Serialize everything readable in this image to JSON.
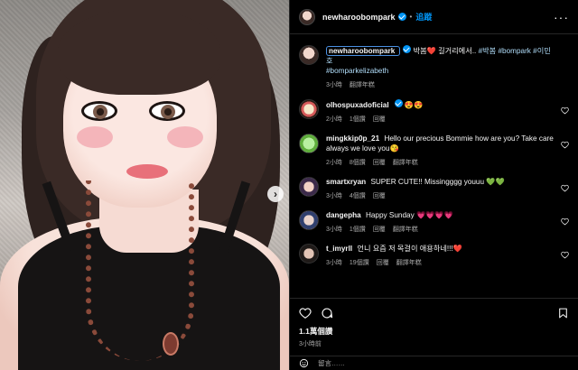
{
  "post": {
    "author": "newharoobompark",
    "follow_label": "追蹤",
    "separator": "•",
    "more_label": "···",
    "caption": {
      "username": "newharoobompark",
      "text_part1": "박봄",
      "emoji": "❤️",
      "text_part2": " 길거리에서..",
      "hashtags_line1": "#박봄 #bompark #이민호",
      "hashtags_line2": "#bomparkelizabeth",
      "time": "3小時",
      "translate": "翻譯年糕"
    },
    "carousel_next": "›",
    "likes": "1.1萬個讚",
    "posted": "3小時前",
    "comment_placeholder": "留言……"
  },
  "comments": [
    {
      "user": "olhospuxadoficial",
      "verified": true,
      "text": "😍😍",
      "time": "2小時",
      "likes": "1個讚",
      "reply": "回覆",
      "translate": ""
    },
    {
      "user": "mingkkip0p_21",
      "verified": false,
      "text": "Hello our precious Bommie how are you? Take care always we love you😘",
      "time": "2小時",
      "likes": "8個讚",
      "reply": "回覆",
      "translate": "翻譯年糕"
    },
    {
      "user": "smartxryan",
      "verified": false,
      "text": "SUPER CUTE!! Missingggg youuu 💚💚",
      "time": "3小時",
      "likes": "4個讚",
      "reply": "回覆",
      "translate": ""
    },
    {
      "user": "dangepha",
      "verified": false,
      "text": "Happy Sunday 💗💗💗💗",
      "time": "3小時",
      "likes": "1個讚",
      "reply": "回覆",
      "translate": "翻譯年糕"
    },
    {
      "user": "t_imyrll",
      "verified": false,
      "text": "언니 요즘 저 목걸이 애용하네!!!❤️",
      "time": "3小時",
      "likes": "19個讚",
      "reply": "回覆",
      "translate": "翻譯年糕"
    }
  ],
  "colors": {
    "accent": "#0095f6",
    "background": "#000000",
    "secondary_text": "#a8a8a8"
  }
}
